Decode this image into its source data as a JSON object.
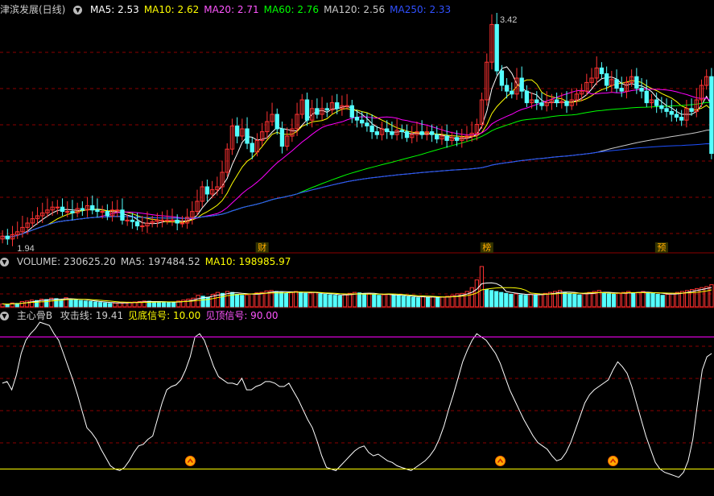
{
  "title": "津滨发展(日线)",
  "colors": {
    "up": "#ff3232",
    "down": "#54ffff",
    "ma5": "#ffffff",
    "ma10": "#ffff00",
    "ma20": "#ff00ff",
    "ma60": "#00ff00",
    "ma120": "#c8c8c8",
    "ma250": "#1e50ff",
    "grid": "#8b0000",
    "divider": "#b00000",
    "header_label": "#cccccc"
  },
  "price_panel": {
    "indicators": [
      {
        "label": "MA5: 2.53",
        "color": "#ffffff"
      },
      {
        "label": "MA10: 2.62",
        "color": "#ffff00"
      },
      {
        "label": "MA20: 2.71",
        "color": "#ff55ff"
      },
      {
        "label": "MA60: 2.76",
        "color": "#00ff00"
      },
      {
        "label": "MA120: 2.56",
        "color": "#c8c8c8"
      },
      {
        "label": "MA250: 2.33",
        "color": "#3050ff"
      }
    ],
    "max_label": "3.42",
    "min_label": "1.94",
    "event_markers": [
      "财",
      "榜",
      "预"
    ]
  },
  "volume_panel": {
    "indicators": [
      {
        "label": "VOLUME: 230625.20",
        "color": "#cccccc"
      },
      {
        "label": "MA5: 197484.52",
        "color": "#cccccc"
      },
      {
        "label": "MA10: 198985.97",
        "color": "#ffff00"
      }
    ]
  },
  "indicator_panel": {
    "name": "主心骨B",
    "indicators": [
      {
        "label": "攻击线: 19.41",
        "color": "#cccccc"
      },
      {
        "label": "见底信号: 10.00",
        "color": "#ffff00"
      },
      {
        "label": "见顶信号: 90.00",
        "color": "#ff55ff"
      }
    ]
  },
  "chart_data": [
    {
      "type": "candlestick",
      "name": "price",
      "ylim": [
        1.85,
        3.5
      ],
      "n": 143,
      "close": [
        1.96,
        1.94,
        1.97,
        1.99,
        2.02,
        2.05,
        2.08,
        2.1,
        2.12,
        2.14,
        2.16,
        2.16,
        2.13,
        2.13,
        2.12,
        2.15,
        2.14,
        2.17,
        2.14,
        2.13,
        2.13,
        2.1,
        2.14,
        2.14,
        2.07,
        2.07,
        2.06,
        2.03,
        2.03,
        2.05,
        2.06,
        2.07,
        2.07,
        2.07,
        2.07,
        2.05,
        2.05,
        2.09,
        2.13,
        2.2,
        2.3,
        2.25,
        2.28,
        2.3,
        2.4,
        2.56,
        2.72,
        2.65,
        2.7,
        2.6,
        2.54,
        2.62,
        2.68,
        2.75,
        2.8,
        2.7,
        2.58,
        2.65,
        2.7,
        2.8,
        2.9,
        2.76,
        2.84,
        2.8,
        2.84,
        2.83,
        2.88,
        2.84,
        2.86,
        2.86,
        2.78,
        2.76,
        2.74,
        2.72,
        2.68,
        2.66,
        2.7,
        2.68,
        2.66,
        2.69,
        2.68,
        2.64,
        2.66,
        2.68,
        2.66,
        2.68,
        2.66,
        2.63,
        2.65,
        2.62,
        2.64,
        2.62,
        2.64,
        2.65,
        2.67,
        2.73,
        2.9,
        3.16,
        3.42,
        3.1,
        3.0,
        2.96,
        2.94,
        3.05,
        2.96,
        2.88,
        2.9,
        2.88,
        2.86,
        2.88,
        2.9,
        2.88,
        2.89,
        2.86,
        2.9,
        2.94,
        2.96,
        3.02,
        3.05,
        3.12,
        3.08,
        3.0,
        3.04,
        2.98,
        2.96,
        3.02,
        3.06,
        2.98,
        2.96,
        2.88,
        2.9,
        2.86,
        2.84,
        2.82,
        2.8,
        2.78,
        2.76,
        2.84,
        2.82,
        2.9,
        3.0,
        3.06,
        2.53
      ],
      "indicators": [
        "MA5",
        "MA10",
        "MA20",
        "MA60",
        "MA120",
        "MA250"
      ],
      "events": [
        {
          "label": "财",
          "bar": 52
        },
        {
          "label": "榜",
          "bar": 97
        },
        {
          "label": "预",
          "bar": 132
        }
      ]
    },
    {
      "type": "bar",
      "name": "VOLUME",
      "ylim": [
        0,
        420000
      ],
      "values": [
        30,
        25,
        40,
        35,
        55,
        60,
        70,
        65,
        80,
        75,
        90,
        85,
        70,
        95,
        80,
        75,
        65,
        60,
        55,
        50,
        45,
        40,
        35,
        38,
        42,
        45,
        48,
        50,
        55,
        60,
        58,
        52,
        50,
        48,
        46,
        44,
        60,
        70,
        80,
        90,
        120,
        110,
        100,
        130,
        150,
        140,
        160,
        150,
        130,
        120,
        125,
        135,
        145,
        150,
        165,
        170,
        160,
        150,
        140,
        155,
        160,
        150,
        140,
        145,
        150,
        135,
        130,
        125,
        120,
        115,
        130,
        140,
        150,
        145,
        135,
        140,
        130,
        120,
        125,
        130,
        120,
        115,
        110,
        105,
        100,
        95,
        110,
        100,
        105,
        95,
        100,
        110,
        120,
        135,
        140,
        160,
        200,
        280,
        420,
        180,
        170,
        160,
        150,
        140,
        130,
        135,
        125,
        120,
        130,
        125,
        130,
        140,
        150,
        160,
        170,
        150,
        140,
        130,
        125,
        135,
        150,
        160,
        170,
        140,
        135,
        130,
        145,
        150,
        160,
        140,
        150,
        160,
        150,
        140,
        130,
        120,
        130,
        140,
        150,
        160,
        170,
        180,
        190,
        200,
        210,
        230
      ],
      "multiplier": 1000
    },
    {
      "type": "line",
      "name": "主心骨B",
      "ylim": [
        0,
        100
      ],
      "series": [
        {
          "name": "攻击线",
          "values": [
            62,
            63,
            58,
            67,
            80,
            88,
            92,
            95,
            99,
            98,
            97,
            92,
            88,
            80,
            72,
            64,
            55,
            45,
            35,
            32,
            28,
            22,
            17,
            12,
            10,
            9,
            11,
            15,
            20,
            24,
            25,
            28,
            30,
            40,
            50,
            58,
            60,
            61,
            64,
            70,
            78,
            90,
            92,
            88,
            80,
            72,
            66,
            64,
            62,
            62,
            61,
            65,
            58,
            58,
            60,
            61,
            63,
            63,
            62,
            60,
            60,
            62,
            57,
            52,
            46,
            40,
            35,
            27,
            18,
            11,
            10,
            9,
            12,
            15,
            18,
            21,
            23,
            24,
            20,
            18,
            19,
            17,
            15,
            14,
            12,
            11,
            10,
            9,
            11,
            13,
            15,
            18,
            22,
            28,
            36,
            46,
            55,
            65,
            75,
            82,
            88,
            92,
            90,
            88,
            84,
            80,
            74,
            66,
            58,
            52,
            46,
            40,
            35,
            30,
            26,
            24,
            22,
            18,
            15,
            16,
            20,
            26,
            34,
            42,
            50,
            55,
            58,
            60,
            62,
            64,
            70,
            75,
            72,
            68,
            60,
            50,
            40,
            30,
            22,
            14,
            10,
            8,
            7,
            6,
            5,
            8,
            15,
            28,
            50,
            70,
            78,
            80
          ]
        },
        {
          "name": "见底信号",
          "value": 10
        },
        {
          "name": "见顶信号",
          "value": 90
        }
      ],
      "signal_bars": [
        40,
        106,
        130,
        165,
        188,
        192,
        196,
        200
      ]
    }
  ]
}
